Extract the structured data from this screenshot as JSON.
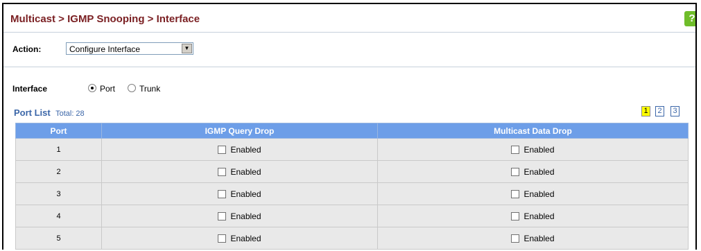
{
  "header": {
    "title": "Multicast > IGMP Snooping > Interface",
    "help_icon": "?"
  },
  "action": {
    "label": "Action:",
    "selected": "Configure Interface"
  },
  "interface": {
    "label": "Interface",
    "options": [
      {
        "label": "Port",
        "checked": true
      },
      {
        "label": "Trunk",
        "checked": false
      }
    ]
  },
  "port_list": {
    "title": "Port List",
    "total": "Total: 28",
    "pages": [
      "1",
      "2",
      "3"
    ],
    "current_page": "1"
  },
  "table": {
    "columns": [
      "Port",
      "IGMP Query Drop",
      "Multicast Data Drop"
    ],
    "rows": [
      {
        "port": "1",
        "query_drop": "Enabled",
        "data_drop": "Enabled"
      },
      {
        "port": "2",
        "query_drop": "Enabled",
        "data_drop": "Enabled"
      },
      {
        "port": "3",
        "query_drop": "Enabled",
        "data_drop": "Enabled"
      },
      {
        "port": "4",
        "query_drop": "Enabled",
        "data_drop": "Enabled"
      },
      {
        "port": "5",
        "query_drop": "Enabled",
        "data_drop": "Enabled"
      }
    ]
  },
  "colors": {
    "title": "#7a1f22",
    "header_bg": "#6d9ee8",
    "link": "#3b66a8",
    "active_page": "#ffff00"
  }
}
